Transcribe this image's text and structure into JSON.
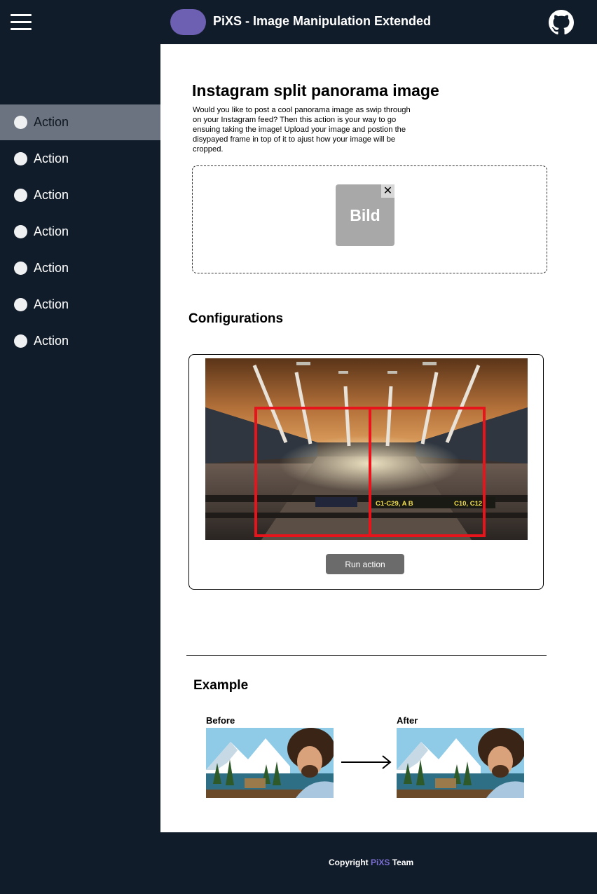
{
  "header": {
    "app_title": "PiXS - Image Manipulation Extended",
    "menu_icon": "hamburger-menu-icon",
    "repo_icon": "github-icon"
  },
  "sidebar": {
    "items": [
      {
        "label": "Action",
        "active": true
      },
      {
        "label": "Action",
        "active": false
      },
      {
        "label": "Action",
        "active": false
      },
      {
        "label": "Action",
        "active": false
      },
      {
        "label": "Action",
        "active": false
      },
      {
        "label": "Action",
        "active": false
      },
      {
        "label": "Action",
        "active": false
      }
    ]
  },
  "main": {
    "title": "Instagram split panorama image",
    "description": "Would you like to post a cool panorama image as swip through on your Instagram feed? Then this action is your way to go ensuing taking the image! Upload your image and postion the disypayed frame in top of it to ajust how your image will be cropped.",
    "upload": {
      "thumbnail_label": "Bild",
      "remove_symbol": "✕"
    },
    "configurations": {
      "heading": "Configurations",
      "run_label": "Run action",
      "sign_text_1": "C1-C29, A B",
      "sign_text_2": "C10, C12"
    },
    "example": {
      "heading": "Example",
      "before_label": "Before",
      "after_label": "After"
    }
  },
  "footer": {
    "prefix": "Copyright",
    "brand": "PiXS",
    "suffix": "Team"
  },
  "colors": {
    "background": "#111c2a",
    "accent": "#6d5fb2",
    "sidebar_active": "#6b7380",
    "frame_red": "#e8141b"
  }
}
